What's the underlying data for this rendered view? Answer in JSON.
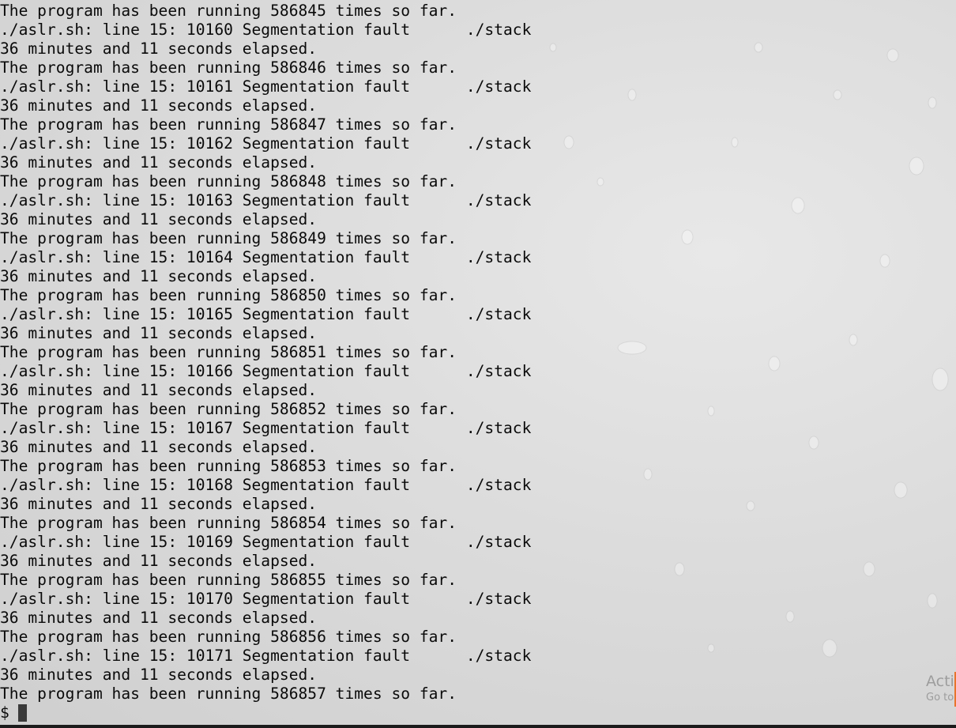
{
  "terminal": {
    "lines": [
      "The program has been running 586845 times so far.",
      "./aslr.sh: line 15: 10160 Segmentation fault      ./stack",
      "36 minutes and 11 seconds elapsed.",
      "The program has been running 586846 times so far.",
      "./aslr.sh: line 15: 10161 Segmentation fault      ./stack",
      "36 minutes and 11 seconds elapsed.",
      "The program has been running 586847 times so far.",
      "./aslr.sh: line 15: 10162 Segmentation fault      ./stack",
      "36 minutes and 11 seconds elapsed.",
      "The program has been running 586848 times so far.",
      "./aslr.sh: line 15: 10163 Segmentation fault      ./stack",
      "36 minutes and 11 seconds elapsed.",
      "The program has been running 586849 times so far.",
      "./aslr.sh: line 15: 10164 Segmentation fault      ./stack",
      "36 minutes and 11 seconds elapsed.",
      "The program has been running 586850 times so far.",
      "./aslr.sh: line 15: 10165 Segmentation fault      ./stack",
      "36 minutes and 11 seconds elapsed.",
      "The program has been running 586851 times so far.",
      "./aslr.sh: line 15: 10166 Segmentation fault      ./stack",
      "36 minutes and 11 seconds elapsed.",
      "The program has been running 586852 times so far.",
      "./aslr.sh: line 15: 10167 Segmentation fault      ./stack",
      "36 minutes and 11 seconds elapsed.",
      "The program has been running 586853 times so far.",
      "./aslr.sh: line 15: 10168 Segmentation fault      ./stack",
      "36 minutes and 11 seconds elapsed.",
      "The program has been running 586854 times so far.",
      "./aslr.sh: line 15: 10169 Segmentation fault      ./stack",
      "36 minutes and 11 seconds elapsed.",
      "The program has been running 586855 times so far.",
      "./aslr.sh: line 15: 10170 Segmentation fault      ./stack",
      "36 minutes and 11 seconds elapsed.",
      "The program has been running 586856 times so far.",
      "./aslr.sh: line 15: 10171 Segmentation fault      ./stack",
      "36 minutes and 11 seconds elapsed.",
      "The program has been running 586857 times so far."
    ],
    "prompt": "$"
  },
  "watermark": {
    "line1": "Acti",
    "line2": "Go to"
  },
  "colors": {
    "text": "#0a0a0a",
    "cursor": "#3a3a3a",
    "background": "#dcdcdc",
    "accent_edge": "#e8742c"
  }
}
